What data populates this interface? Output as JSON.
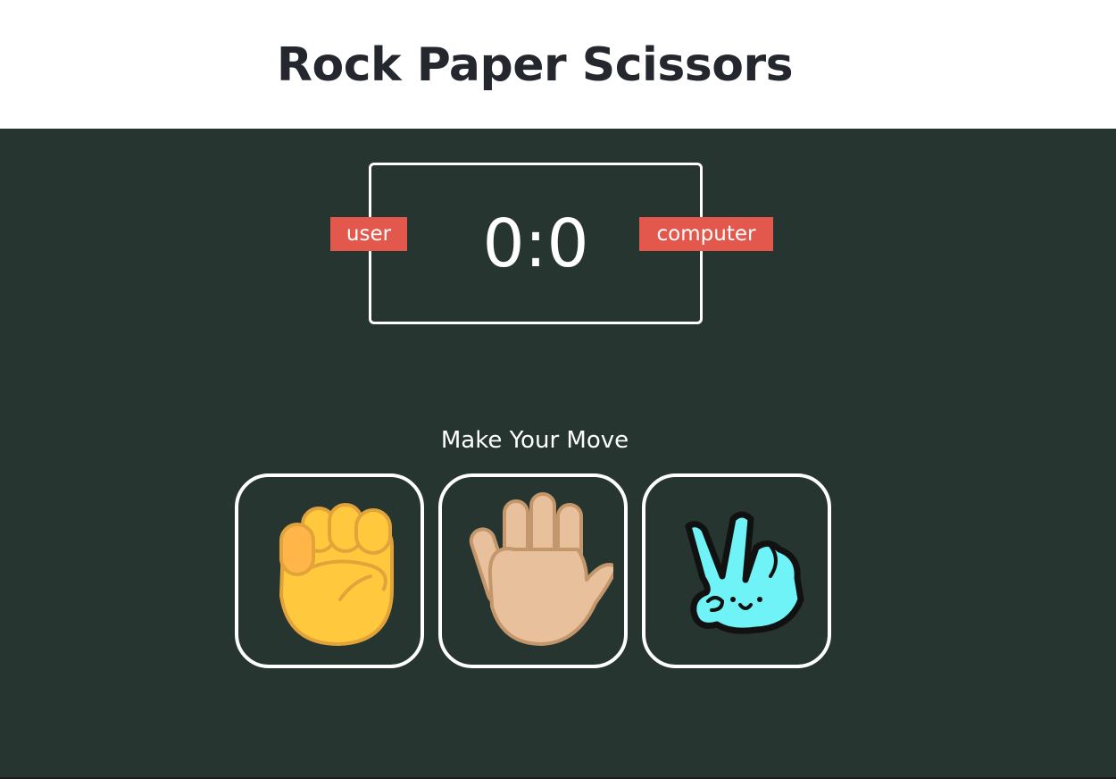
{
  "header": {
    "title": "Rock Paper Scissors"
  },
  "scoreboard": {
    "score": "0:0",
    "user_label": "user",
    "computer_label": "computer"
  },
  "prompt": "Make Your Move",
  "choices": [
    {
      "id": "rock",
      "icon": "raised-fist-icon"
    },
    {
      "id": "paper",
      "icon": "raised-hand-icon"
    },
    {
      "id": "scissors",
      "icon": "victory-hand-icon"
    }
  ],
  "colors": {
    "background": "#263530",
    "header_background": "#ffffff",
    "title": "#24272e",
    "badge": "#e2584d",
    "border": "#ffffff",
    "fist": "#ffc83d",
    "hand": "#e8c19c",
    "scissors": "#6ff3f7"
  }
}
